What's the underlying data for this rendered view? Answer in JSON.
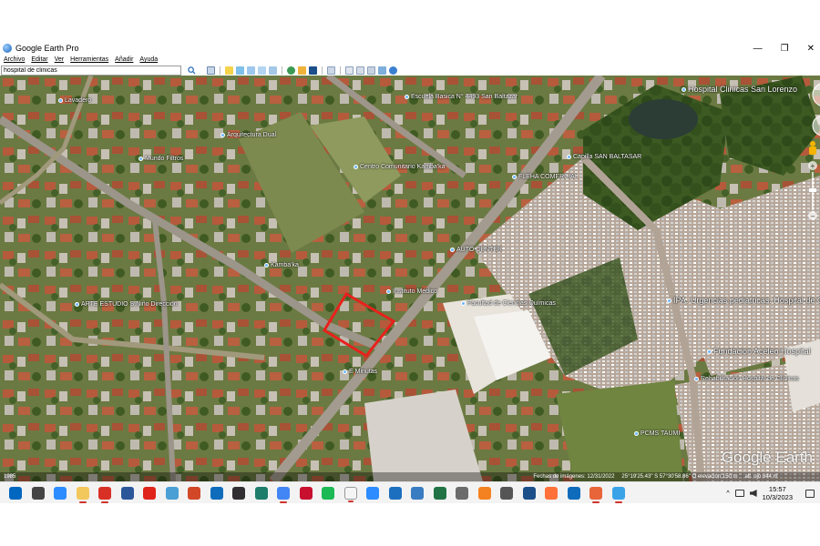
{
  "window": {
    "title": "Google Earth Pro",
    "controls": {
      "minimize": "—",
      "maximize": "❐",
      "close": "✕"
    }
  },
  "menu": [
    "Archivo",
    "Editar",
    "Ver",
    "Herramientas",
    "Añadir",
    "Ayuda"
  ],
  "search": {
    "value": "hospital de clinicas"
  },
  "map_labels": [
    {
      "text": "Hospital Clinicas San Lorenzo",
      "big": true
    },
    {
      "text": "Escuela Basica N° 4493 San Baltazar"
    },
    {
      "text": "Lavadero"
    },
    {
      "text": "Centro Comunitario Kamba'ka"
    },
    {
      "text": "Capilla SAN BALTASAR"
    },
    {
      "text": "Arquitectura Dual"
    },
    {
      "text": "Mundo Filtros"
    },
    {
      "text": "AUTO CENTER"
    },
    {
      "text": "Facultad de Ciencias Químicas"
    },
    {
      "text": "Instituto Médico"
    },
    {
      "text": "ARTE ESTUDIO S.Niño Dirección"
    },
    {
      "text": "IPA. Urgencias pediatricas. Hospital de Clinicas"
    },
    {
      "text": "Fundacion Aceleo Hospital"
    },
    {
      "text": "Rehabilitación Hospital de Clínicas"
    },
    {
      "text": "E Minutas"
    },
    {
      "text": "PCMS TAUMI"
    },
    {
      "text": "Kamba'ka"
    },
    {
      "text": "FLEHA COMERCIAL"
    }
  ],
  "map_logo": "Google Earth",
  "status": {
    "year": "1985",
    "imagery_date": "Fechas de imágenes: 12/31/2022",
    "coords": "25°19'25.43\" S   57°30'58.86\" O   elevación   150 m",
    "eye_alt": "alt. ojo   844 m"
  },
  "taskbar": {
    "time": "15:57",
    "date": "10/3/2023",
    "tray_arrow": "^",
    "apps": [
      {
        "icon": "windows-icon",
        "color": "#0067c0"
      },
      {
        "icon": "search-icon",
        "color": "#444444"
      },
      {
        "icon": "zoom-icon",
        "color": "#2d8cff"
      },
      {
        "icon": "folder-icon",
        "color": "#f2c75c",
        "active": true
      },
      {
        "icon": "mail-m-icon",
        "color": "#d93025",
        "active": true
      },
      {
        "icon": "word-icon",
        "color": "#2b579a"
      },
      {
        "icon": "acrobat-icon",
        "color": "#e0241b"
      },
      {
        "icon": "monitor-icon",
        "color": "#4a9fd5"
      },
      {
        "icon": "powerpoint-icon",
        "color": "#d24726"
      },
      {
        "icon": "mail-icon",
        "color": "#0f6cbd"
      },
      {
        "icon": "obs-icon",
        "color": "#302e31"
      },
      {
        "icon": "terminal-icon",
        "color": "#1e7d6b"
      },
      {
        "icon": "chrome-icon",
        "color": "#4285f4",
        "active": true
      },
      {
        "icon": "autocad-icon",
        "color": "#c8102e"
      },
      {
        "icon": "spotify-icon",
        "color": "#1db954"
      },
      {
        "icon": "notepad-icon",
        "color": "#f5f5f5",
        "active": true
      },
      {
        "icon": "zoom-meet-icon",
        "color": "#2d8cff"
      },
      {
        "icon": "remote-icon",
        "color": "#1c6fbf"
      },
      {
        "icon": "globe-icon",
        "color": "#3a7cc1"
      },
      {
        "icon": "excel-icon",
        "color": "#217346"
      },
      {
        "icon": "calculator-icon",
        "color": "#6b6b6b"
      },
      {
        "icon": "vlc-icon",
        "color": "#f58220"
      },
      {
        "icon": "usb-icon",
        "color": "#555555"
      },
      {
        "icon": "cube-icon",
        "color": "#1b4f8a"
      },
      {
        "icon": "firefox-icon",
        "color": "#ff7139"
      },
      {
        "icon": "outlook-icon",
        "color": "#0f6cbd"
      },
      {
        "icon": "google-earth-icon",
        "color": "#e8653a",
        "active": true
      },
      {
        "icon": "photos-icon",
        "color": "#3aa3e8",
        "active": true
      }
    ]
  }
}
